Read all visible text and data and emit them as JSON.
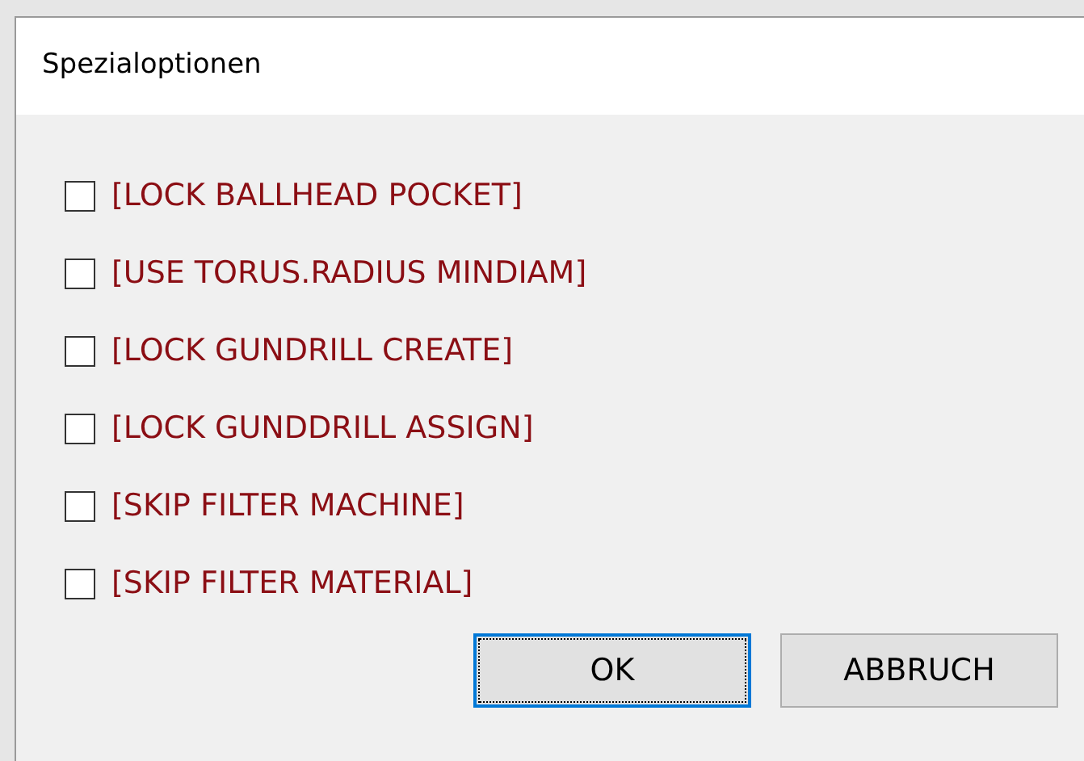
{
  "window": {
    "title": "Spezialoptionen"
  },
  "options": [
    {
      "label": "[LOCK BALLHEAD POCKET]",
      "checked": false
    },
    {
      "label": "[USE TORUS.RADIUS MINDIAM]",
      "checked": false
    },
    {
      "label": "[LOCK GUNDRILL CREATE]",
      "checked": false
    },
    {
      "label": "[LOCK GUNDDRILL ASSIGN]",
      "checked": false
    },
    {
      "label": "[SKIP FILTER MACHINE]",
      "checked": false
    },
    {
      "label": "[SKIP FILTER MATERIAL]",
      "checked": false
    }
  ],
  "buttons": [
    {
      "label": "OK",
      "focused": true
    },
    {
      "label": "ABBRUCH",
      "focused": false
    }
  ]
}
